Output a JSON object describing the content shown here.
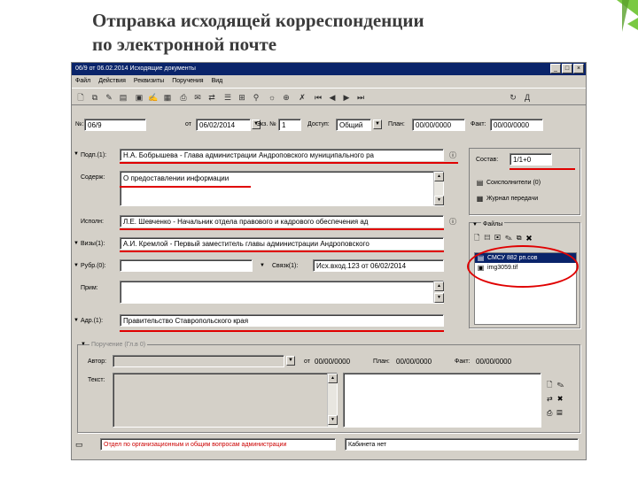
{
  "slide": {
    "title_line1": "Отправка исходящей корреспонденции",
    "title_line2": "по электронной почте"
  },
  "window": {
    "title": "06/9 от 06.02.2014 Исходящие документы",
    "controls": [
      "_",
      "□",
      "×"
    ]
  },
  "menu": [
    "Файл",
    "Действия",
    "Реквизиты",
    "Поручения",
    "Вид"
  ],
  "toolbar": {
    "icons": [
      "new-doc-icon",
      "copy-doc-icon",
      "edit-doc-icon",
      "delete-doc-icon",
      "save-icon",
      "edit-icon",
      "register-icon",
      "print-icon",
      "print-preview-icon",
      "send-icon",
      "view-icon",
      "search-icon",
      "settings-icon",
      "tree-icon",
      "send-email-icon",
      "close-red-icon",
      "first-icon",
      "prev-icon",
      "next-icon",
      "last-icon",
      "refresh-icon",
      "help-icon"
    ]
  },
  "header": {
    "number_label": "№:",
    "number_value": "06/9",
    "from_label": "от",
    "date_value": "06/02/2014",
    "copies_label": "Экз. №",
    "copies_value": "1",
    "access_label": "Доступ:",
    "access_value": "Общий",
    "plan_label": "План:",
    "plan_value": "00/00/0000",
    "fact_label": "Факт:",
    "fact_value": "00/00/0000"
  },
  "form": {
    "signed_label": "Подп.(1):",
    "signed_value": "Н.А. Бобрышева - Глава администрации Андроповского муниципального ра",
    "content_label": "Содерж:",
    "content_value": "О предоставлении информации",
    "executor_label": "Исполн:",
    "executor_value": "Л.Е. Шевченко - Начальник отдела правового и кадрового обеспечения ад",
    "visa_label": "Визы(1):",
    "visa_value": "А.И. Кремлой - Первый заместитель главы администрации Андроповского",
    "rubric_label": "Рубр.(0):",
    "rubric_value": "",
    "link_label": "Связк(1):",
    "link_value": "Исх.вход.123 от 06/02/2014",
    "note_label": "Прим:",
    "note_value": "",
    "addressee_label": "Адр.(1):",
    "addressee_value": "Правительство Ставропольского края"
  },
  "right_panel": {
    "sheets_label": "Состав:",
    "sheets_value": "1/1+0",
    "coexecutors": "Соисполнители (0)",
    "journal": "Журнал передачи",
    "files_label": "Файлы",
    "files": [
      "СМСУ 882 рп.сов",
      "img3059.tif"
    ]
  },
  "assignment": {
    "group_label": "Поручение (Гл.в 0)",
    "author_label": "Автор:",
    "author_value": "",
    "from_label": "от",
    "from_value": "00/00/0000",
    "plan_label": "План:",
    "plan_value": "00/00/0000",
    "fact_label": "Факт:",
    "fact_value": "00/00/0000",
    "text_label": "Текст:"
  },
  "status": {
    "department": "Отдел по организационным и общим вопросам администрации",
    "cabinet": "Кабинета нет"
  },
  "colors": {
    "accent_red": "#e00000",
    "titlebar_blue": "#0a246a",
    "window_face": "#d4d0c8",
    "deco_green": "#7ac943"
  }
}
